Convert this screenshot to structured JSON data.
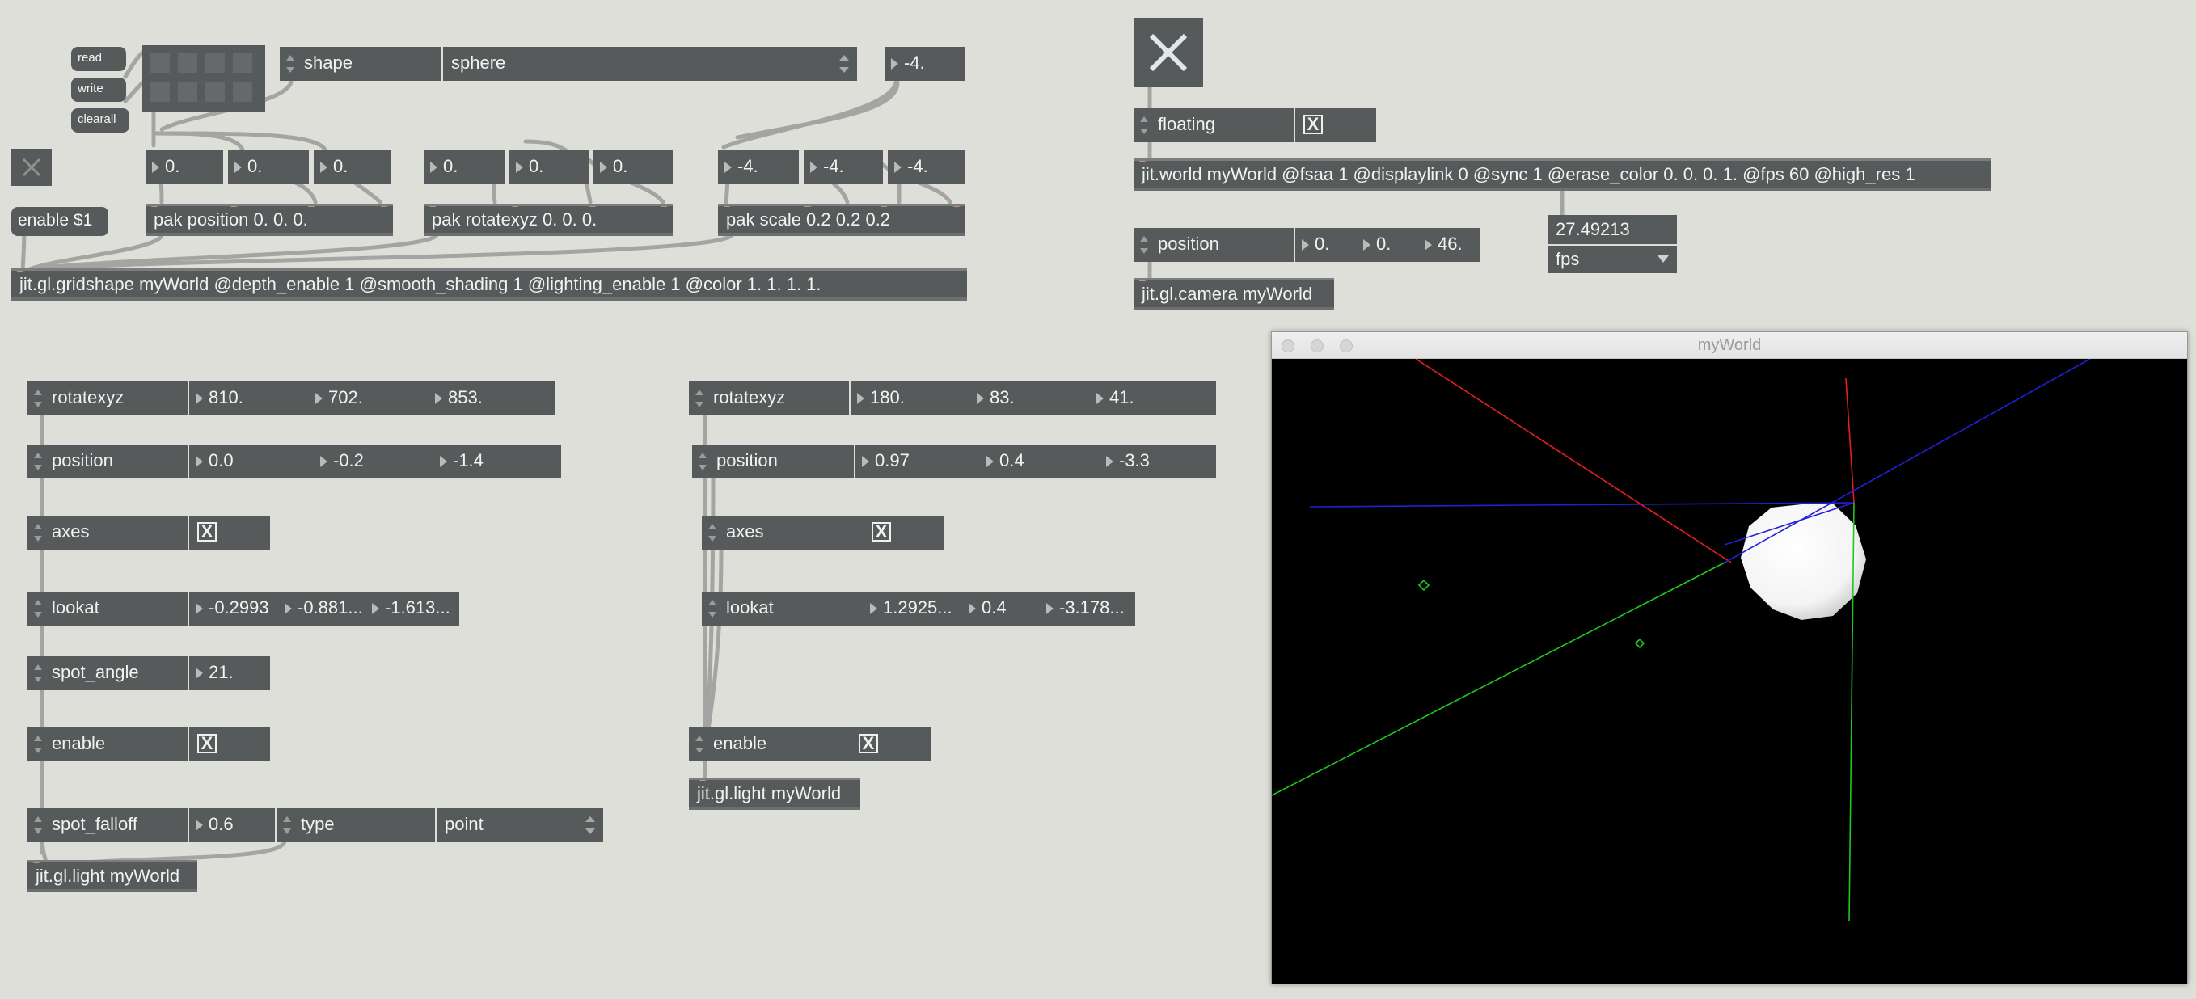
{
  "colors": {
    "background": "#dfdfd9",
    "object": "#575a5a",
    "axis_x": "#e81e1e",
    "axis_y": "#1ec81e",
    "axis_z": "#2020d8"
  },
  "preset": {
    "read": "read",
    "write": "write",
    "clearall": "clearall"
  },
  "gridshape": {
    "shape_label": "shape",
    "shape_value": "sphere",
    "scale_input": "-4.",
    "enable_msg": "enable $1",
    "pos": [
      "0.",
      "0.",
      "0."
    ],
    "rot": [
      "0.",
      "0.",
      "0."
    ],
    "scale": [
      "-4.",
      "-4.",
      "-4."
    ],
    "pak_position": "pak position 0. 0. 0.",
    "pak_rotate": "pak rotatexyz 0. 0. 0.",
    "pak_scale": "pak scale 0.2 0.2 0.2",
    "object": "jit.gl.gridshape myWorld @depth_enable 1 @smooth_shading 1 @lighting_enable 1 @color 1. 1. 1. 1."
  },
  "world": {
    "close_icon": "close-icon",
    "floating_label": "floating",
    "floating_checked": "X",
    "object": "jit.world myWorld @fsaa 1 @displaylink 0 @sync 1 @erase_color 0. 0. 0. 1. @fps 60 @high_res 1",
    "fps_value": "27.49213",
    "fps_menu": "fps"
  },
  "camera": {
    "position_label": "position",
    "position": [
      "0.",
      "0.",
      "46."
    ],
    "object": "jit.gl.camera myWorld"
  },
  "light1": {
    "rotate_label": "rotatexyz",
    "rotate": [
      "810.",
      "702.",
      "853."
    ],
    "position_label": "position",
    "position": [
      "0.0",
      "-0.2",
      "-1.4"
    ],
    "axes_label": "axes",
    "axes_checked": "X",
    "lookat_label": "lookat",
    "lookat": [
      "-0.2993",
      "-0.881...",
      "-1.613..."
    ],
    "spot_angle_label": "spot_angle",
    "spot_angle": "21.",
    "enable_label": "enable",
    "enable_checked": "X",
    "spot_falloff_label": "spot_falloff",
    "spot_falloff": "0.6",
    "type_label": "type",
    "type_value": "point",
    "object": "jit.gl.light myWorld"
  },
  "light2": {
    "rotate_label": "rotatexyz",
    "rotate": [
      "180.",
      "83.",
      "41."
    ],
    "position_label": "position",
    "position": [
      "0.97",
      "0.4",
      "-3.3"
    ],
    "axes_label": "axes",
    "axes_checked": "X",
    "lookat_label": "lookat",
    "lookat": [
      "1.2925...",
      "0.4",
      "-3.178..."
    ],
    "enable_label": "enable",
    "enable_checked": "X",
    "object": "jit.gl.light myWorld"
  },
  "render_window": {
    "title": "myWorld"
  }
}
